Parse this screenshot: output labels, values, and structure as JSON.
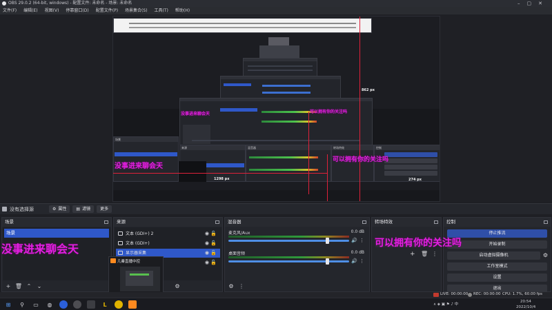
{
  "window": {
    "title": "OBS 29.0.2 (64-bit, windows) - 配置文件: 未命名 - 场景: 未命名"
  },
  "menu": [
    "文件(F)",
    "编辑(E)",
    "视图(V)",
    "停靠窗口(D)",
    "配置文件(P)",
    "场景集合(S)",
    "工具(T)",
    "帮助(H)"
  ],
  "preview": {
    "measure_vertical": "862 px",
    "measure_horizontal": "1298 px",
    "measure_small": "274 px",
    "inner_overlay_1": "没事进来聊会天",
    "inner_overlay_2": "可以拥有你的关注吗"
  },
  "source_toolbar": {
    "source_name": "没有选择源",
    "properties": "属性",
    "filters": "滤镜",
    "more": "更多"
  },
  "overlays": {
    "left": "没事进来聊会天",
    "right": "可以拥有你的关注吗"
  },
  "scenes": {
    "title": "场景",
    "items": [
      "场景"
    ]
  },
  "sources": {
    "title": "来源",
    "items": [
      {
        "label": "文本 (GDI+) 2",
        "selected": false
      },
      {
        "label": "文本 (GDI+)",
        "selected": false
      },
      {
        "label": "显示器采集",
        "selected": true
      },
      {
        "label": "",
        "selected": false
      }
    ]
  },
  "mixer": {
    "title": "混音器",
    "channels": [
      {
        "name": "麦克风/Aux",
        "db": "0.0 dB",
        "level": 0.82
      },
      {
        "name": "桌面音频",
        "db": "0.0 dB",
        "level": 0.82
      }
    ]
  },
  "transitions": {
    "title": "转场特效"
  },
  "controls": {
    "title": "控制",
    "buttons": [
      {
        "label": "停止推流",
        "active": true
      },
      {
        "label": "开始录制",
        "active": false
      },
      {
        "label": "启动虚拟摄像机",
        "active": false
      },
      {
        "label": "工作室模式",
        "active": false
      },
      {
        "label": "设置",
        "active": false
      },
      {
        "label": "退出",
        "active": false
      }
    ]
  },
  "thumb": {
    "title": "几秦直播中控"
  },
  "statusbar": {
    "live": "LIVE: 00:00:00",
    "rec": "REC: 00:00:00",
    "cpu": "CPU: 1.7%, 60.00 fps"
  },
  "taskbar": {
    "time": "20:54",
    "date": "2022/10/4"
  },
  "colors": {
    "accent": "#2f58c9",
    "overlay": "#e21fe0",
    "guide": "#e0213a"
  }
}
